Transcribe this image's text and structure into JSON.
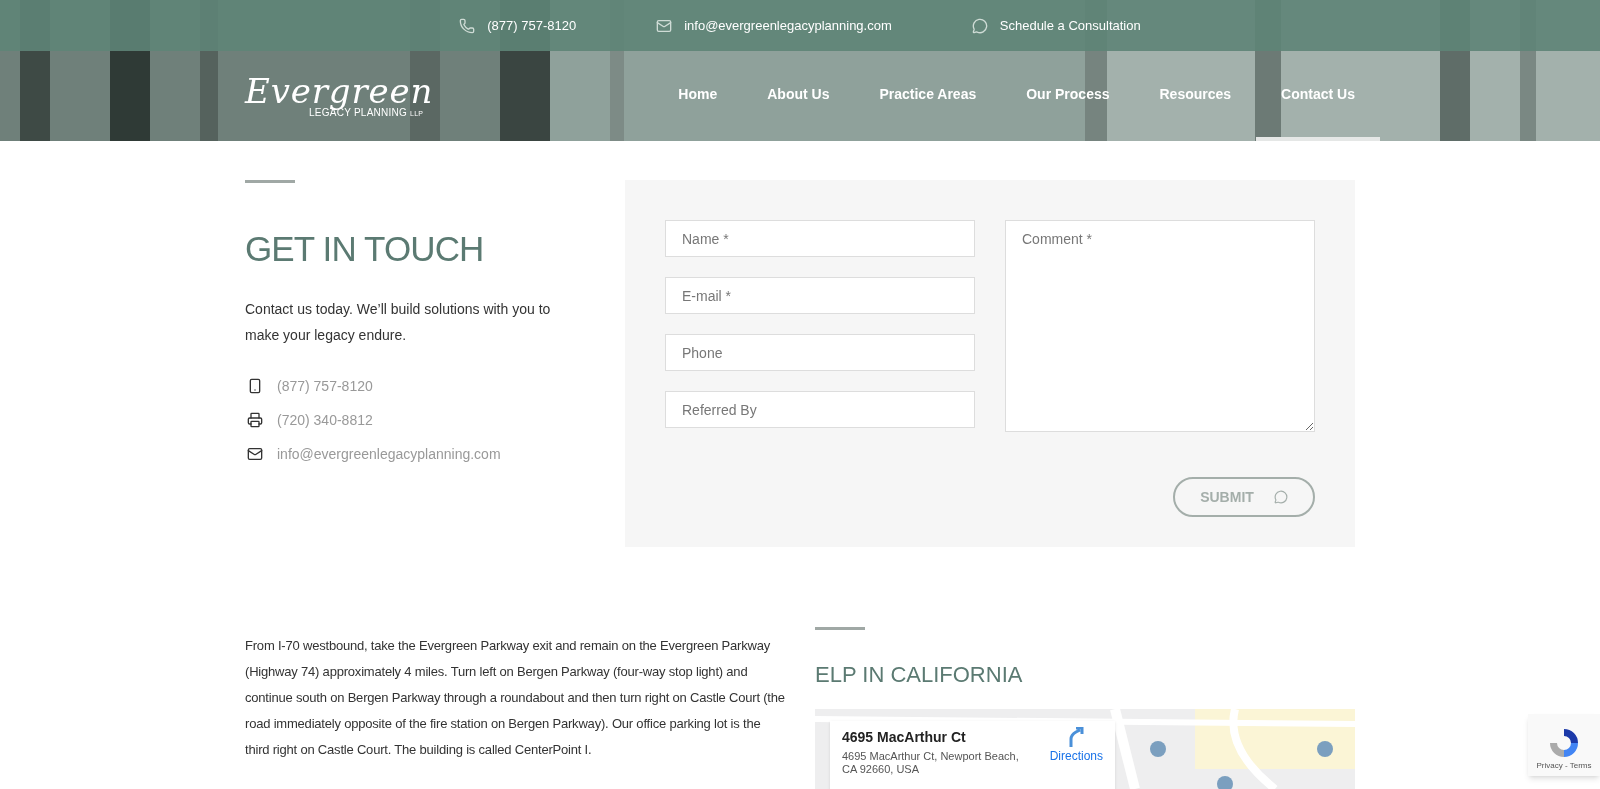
{
  "top_bar": {
    "phone": "(877) 757-8120",
    "email": "info@evergreenlegacyplanning.com",
    "schedule": "Schedule a Consultation"
  },
  "logo": {
    "script": "Evergreen",
    "subtitle": "LEGACY PLANNING",
    "suffix": "LLP"
  },
  "nav": [
    {
      "label": "Home",
      "selected": false
    },
    {
      "label": "About Us",
      "selected": false
    },
    {
      "label": "Practice Areas",
      "selected": false
    },
    {
      "label": "Our Process",
      "selected": false
    },
    {
      "label": "Resources",
      "selected": false
    },
    {
      "label": "Contact Us",
      "selected": true
    }
  ],
  "contact": {
    "heading": "GET IN TOUCH",
    "intro": "Contact us today. We’ll build solutions with you to make your legacy endure.",
    "items": [
      {
        "kind": "mobile",
        "text": "(877) 757-8120"
      },
      {
        "kind": "fax",
        "text": "(720) 340-8812"
      },
      {
        "kind": "email",
        "text": "info@evergreenlegacyplanning.com"
      }
    ]
  },
  "form": {
    "fields": [
      {
        "placeholder": "Name *"
      },
      {
        "placeholder": "E-mail *"
      },
      {
        "placeholder": "Phone"
      },
      {
        "placeholder": "Referred By"
      }
    ],
    "comment": {
      "placeholder": "Comment *"
    },
    "submit": "SUBMIT"
  },
  "directions": "From I-70 westbound, take the Evergreen Parkway exit and remain on the Evergreen Parkway (Highway 74) approximately 4 miles. Turn left on Bergen Parkway (four-way stop light) and continue south on Bergen Parkway through a roundabout and then turn right on Castle Court (the road immediately opposite of the fire station on Bergen Parkway). Our office parking lot is the third right on Castle Court. The building is called CenterPoint I.",
  "california": {
    "heading": "ELP IN CALIFORNIA",
    "map_card": {
      "title": "4695 MacArthur Ct",
      "address": "4695 MacArthur Ct, Newport Beach, CA 92660, USA",
      "directions": "Directions"
    }
  },
  "recaptcha": {
    "links": "Privacy - Terms"
  }
}
